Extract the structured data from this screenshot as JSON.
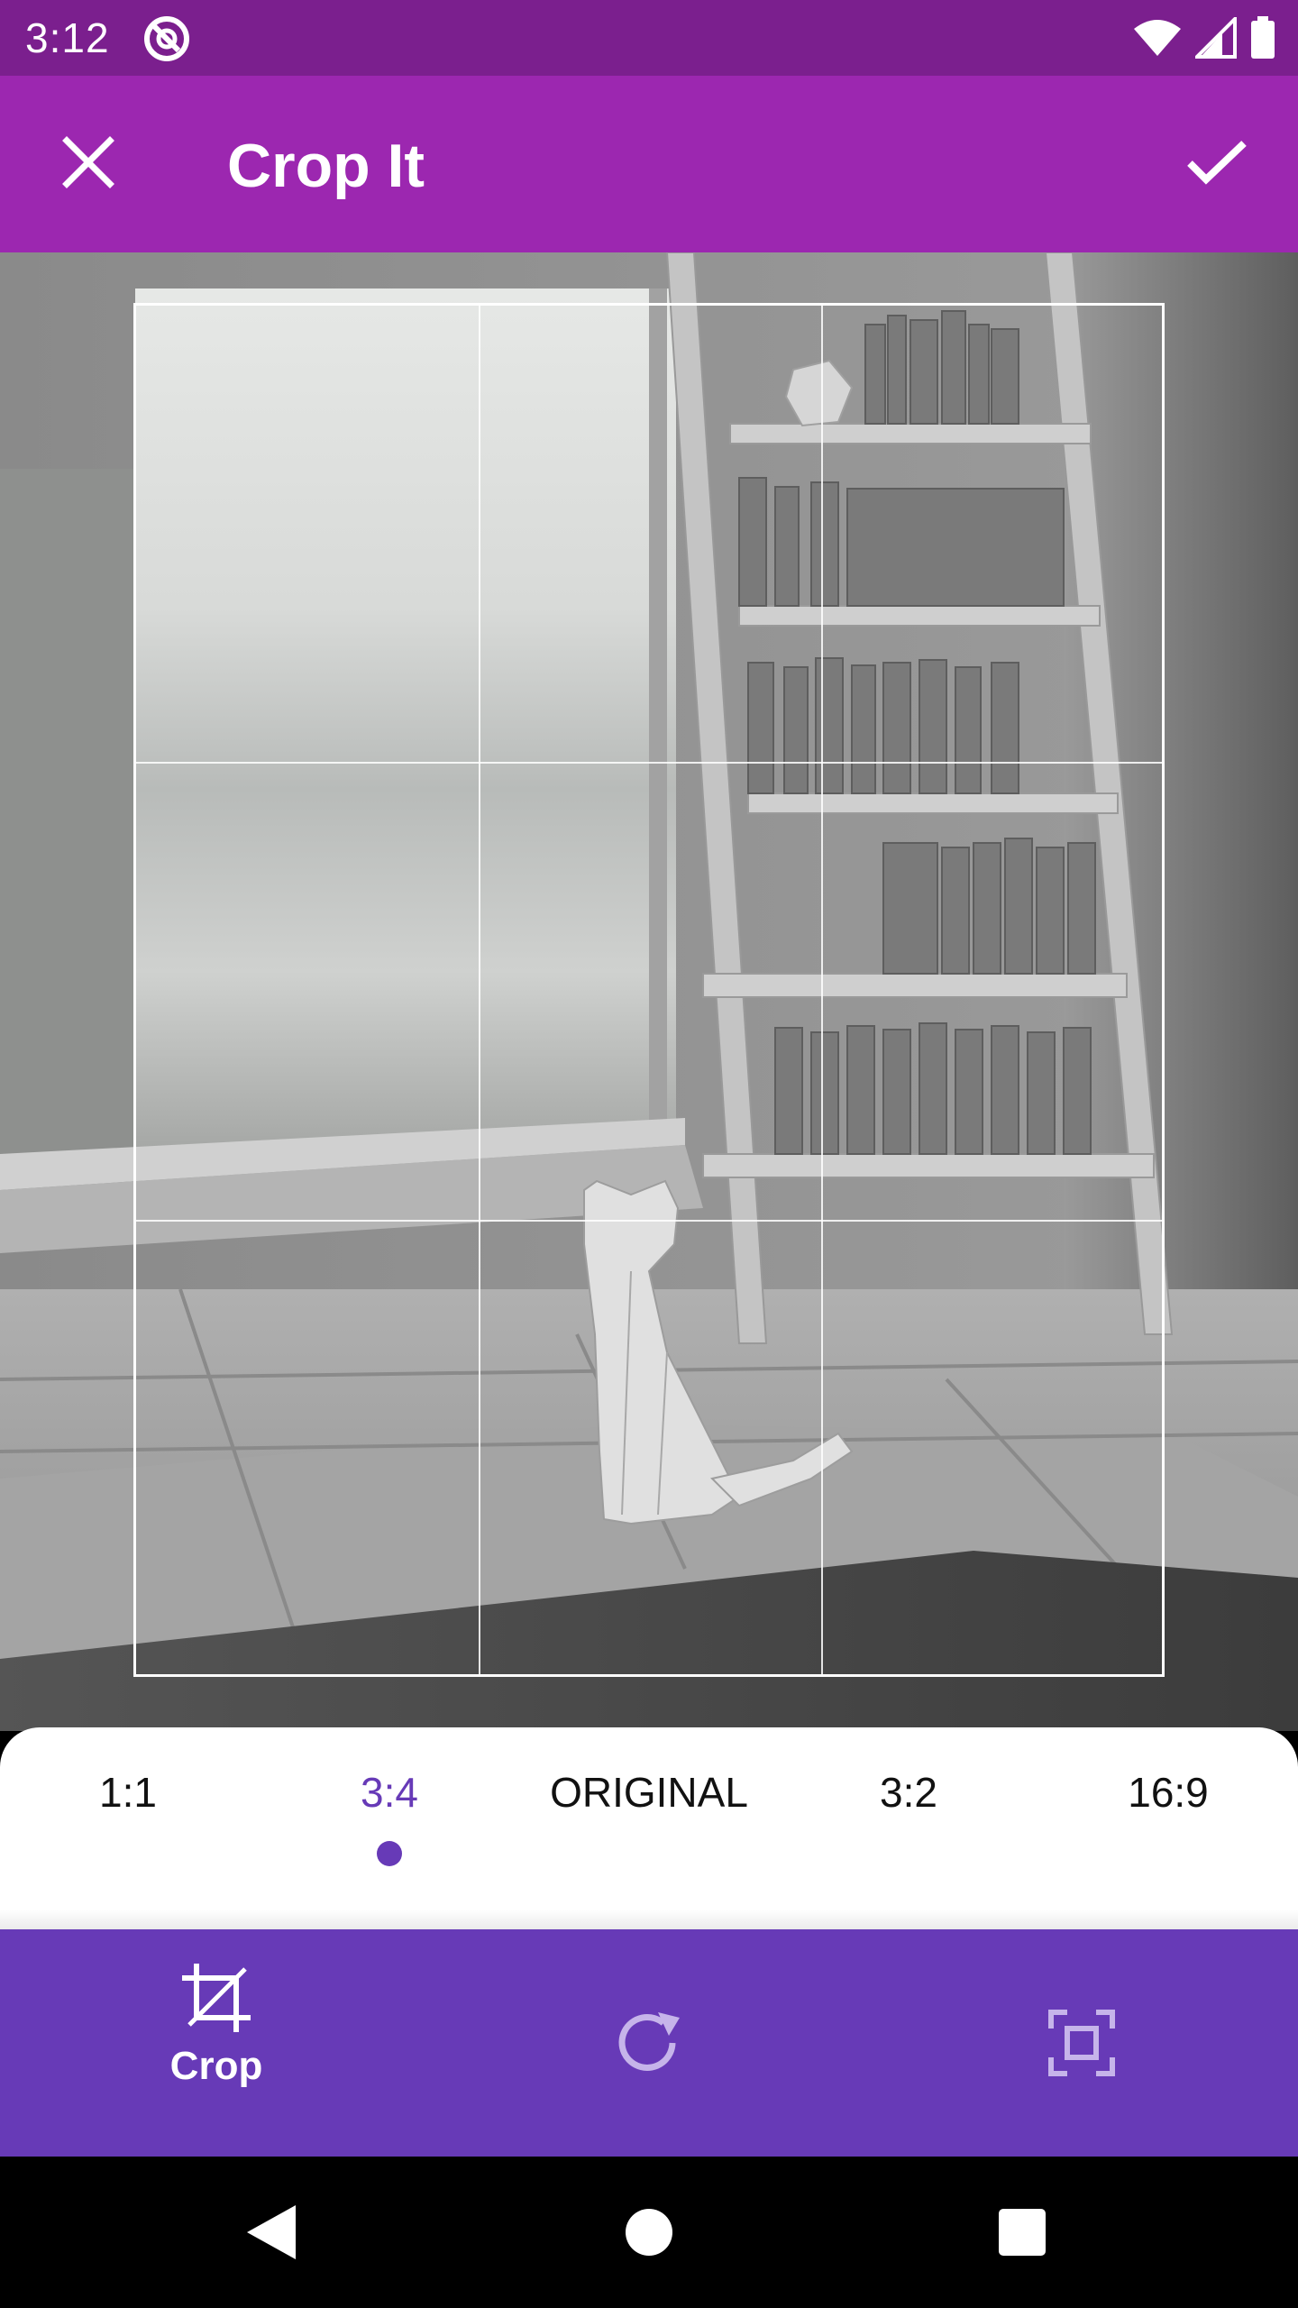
{
  "status_bar": {
    "time": "3:12",
    "icons": [
      "app-notification-icon",
      "wifi-icon",
      "cellular-signal-icon",
      "battery-icon"
    ]
  },
  "app_bar": {
    "title": "Crop It",
    "close_icon": "close-icon",
    "confirm_icon": "check-icon"
  },
  "aspect_ratios": {
    "items": [
      "1:1",
      "3:4",
      "ORIGINAL",
      "3:2",
      "16:9"
    ],
    "selected": "3:4"
  },
  "toolbar": {
    "crop_label": "Crop",
    "crop_icon": "crop-icon",
    "rotate_icon": "rotate-icon",
    "fit_icon": "fit-screen-icon"
  },
  "nav_bar": {
    "icons": [
      "back-icon",
      "home-icon",
      "recents-icon"
    ]
  },
  "colors": {
    "status_bar": "#7b1f8e",
    "app_bar": "#9c27b0",
    "toolbar": "#673ab7",
    "accent": "#673ab7"
  }
}
